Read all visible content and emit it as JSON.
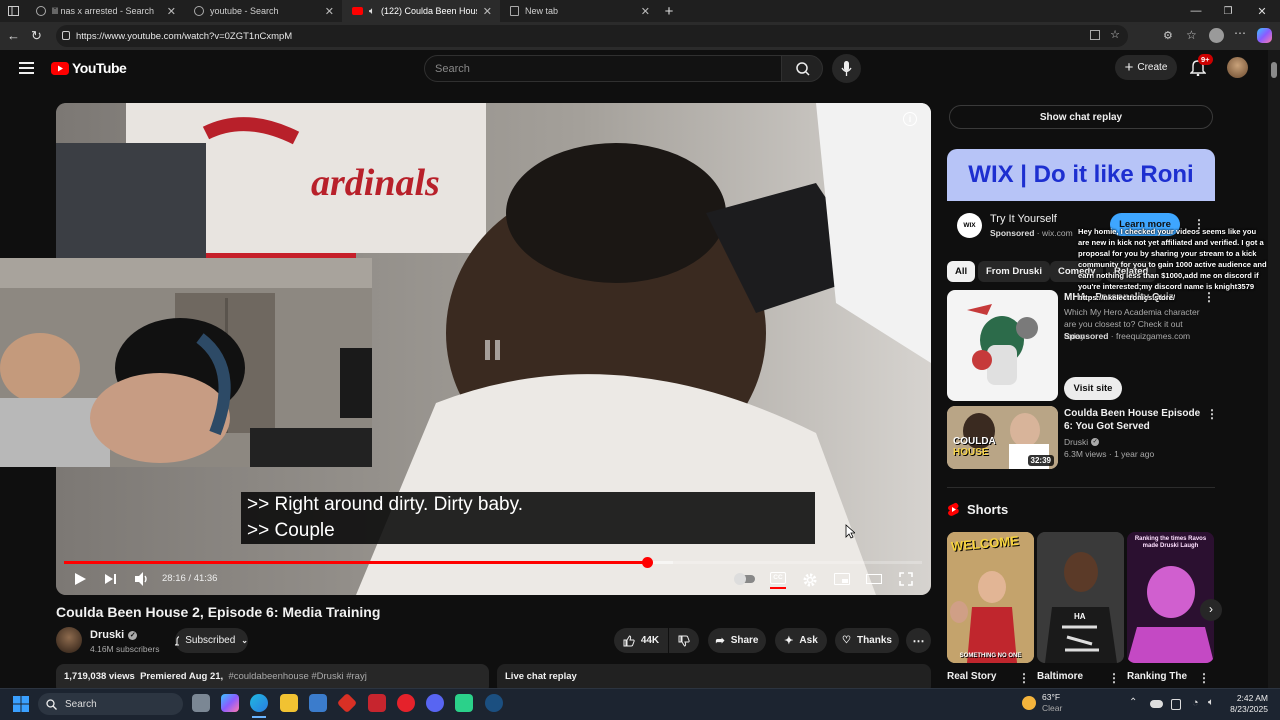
{
  "browser": {
    "tabs": [
      {
        "label": "lil nas x arrested - Search",
        "active": false
      },
      {
        "label": "youtube - Search",
        "active": false
      },
      {
        "label": "(122) Coulda Been House 2,",
        "active": true
      },
      {
        "label": "New tab",
        "active": false
      }
    ],
    "url": "https://www.youtube.com/watch?v=0ZGT1nCxmpM"
  },
  "youtube": {
    "logo_text": "YouTube",
    "search_placeholder": "Search",
    "create_label": "Create",
    "notification_count": "9+"
  },
  "player": {
    "caption_line1": ">> Right around dirty. Dirty baby.",
    "caption_line2": ">> Couple",
    "time": "28:16 / 41:36",
    "progress_fraction": 0.68,
    "buffered_fraction": 0.71
  },
  "video": {
    "title": "Coulda Been House 2, Episode 6: Media Training",
    "channel": "Druski",
    "subscribers": "4.16M subscribers",
    "subscribed_label": "Subscribed",
    "likes": "44K",
    "share_label": "Share",
    "ask_label": "Ask",
    "thanks_label": "Thanks",
    "views": "1,719,038 views",
    "premiered": "Premiered Aug 21,",
    "tags": "#couldabeenhouse #Druski #rayj",
    "live_chat_label": "Live chat replay"
  },
  "sidebar": {
    "show_chat": "Show chat replay",
    "ad": {
      "banner_text": "WIX | Do it like Roni",
      "title": "Try It Yourself",
      "sponsored": "Sponsored",
      "domain": "wix.com",
      "learn_more": "Learn more",
      "logo": "WIX"
    },
    "chips": [
      "All",
      "From Druski",
      "Comedy",
      "Related"
    ],
    "quiz_ad": {
      "title": "MHA - Personality Quiz",
      "desc": "Which My Hero Academia character are you closest to? Check it out today",
      "sponsored": "Sponsored",
      "domain": "freequizgames.com",
      "visit": "Visit site"
    },
    "video1": {
      "title": "Coulda Been House Episode 6: You Got Served",
      "channel": "Druski",
      "meta": "6.3M views · 1 year ago",
      "duration": "32:39",
      "thumb_text1": "COULDA",
      "thumb_text2": "HOUSE"
    },
    "shorts_title": "Shorts",
    "shorts": [
      {
        "title": "Real Story",
        "thumb_text": "WELCOME",
        "caption": "SOMETHING NO ONE"
      },
      {
        "title": "Baltimore",
        "thumb_text": "HA"
      },
      {
        "title": "Ranking The",
        "thumb_text": "Ranking the times Ravos made Druski Laugh"
      }
    ]
  },
  "overlay_chat": "Hey homie, I checked your videos seems like you are new in kick not yet affiliated and verified. I got a proposal for you by sharing your stream to a kick community for you to gain 1000 active audience and earn nothing less than $1000,add me on discord if you're interested;my discord name is knight3579 https://nkelectronics.store/",
  "taskbar": {
    "search_label": "Search",
    "weather_temp": "63°F",
    "weather_desc": "Clear",
    "time": "2:42 AM",
    "date": "8/23/2025"
  },
  "colors": {
    "accent_red": "#ff0000",
    "wix_banner": "#b7c4f7",
    "wix_text": "#1d2fd0",
    "learn_more": "#3ea6ff"
  }
}
